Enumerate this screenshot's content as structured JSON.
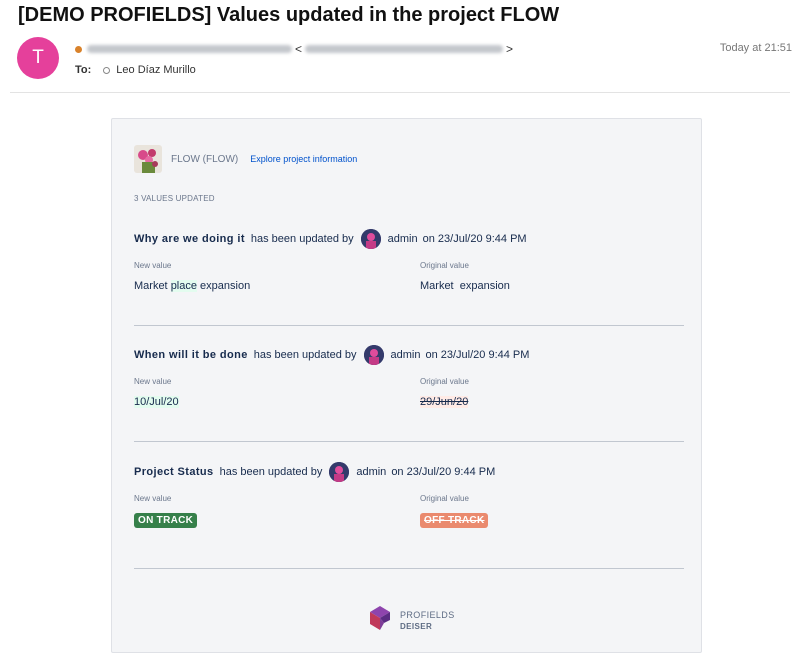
{
  "email": {
    "subject": "[DEMO PROFIELDS] Values updated in the project FLOW",
    "avatar_letter": "T",
    "to_label": "To:",
    "recipient": "Leo Díaz Murillo",
    "date": "Today at 21:51",
    "bracket_open": "<",
    "bracket_close": ">"
  },
  "card": {
    "project_name": "FLOW (FLOW)",
    "project_link": "Explore project information",
    "updated_count": "3 VALUES UPDATED",
    "updated_by_text": "has been updated by",
    "user": "admin",
    "new_value_label": "New value",
    "original_value_label": "Original value",
    "updates": [
      {
        "field": "Why are we doing it",
        "timestamp": "on 23/Jul/20 9:44 PM",
        "new_parts": [
          "Market ",
          "place",
          " expansion"
        ],
        "original": "Market  expansion"
      },
      {
        "field": "When will it be done",
        "timestamp": "on 23/Jul/20 9:44 PM",
        "new_value": "10/Jul/20",
        "original": "29/Jun/20"
      },
      {
        "field": "Project Status",
        "timestamp": "on 23/Jul/20 9:44 PM",
        "new_value": "ON TRACK",
        "original": "OFF TRACK"
      }
    ],
    "logo": {
      "line1": "PROFIELDS",
      "line2": "DEISER"
    }
  },
  "colors": {
    "avatar": "#e5409b",
    "on_track": "#36804a",
    "off_track": "#ea8a6e",
    "link": "#0052cc"
  }
}
